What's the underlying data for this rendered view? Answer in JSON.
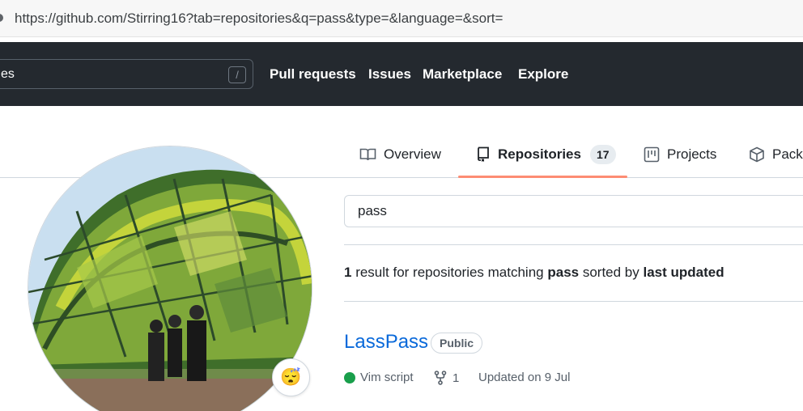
{
  "browser": {
    "url": "https://github.com/Stirring16?tab=repositories&q=pass&type=&language=&sort="
  },
  "header": {
    "search_text": "es",
    "search_shortcut": "/",
    "nav": [
      "Pull requests",
      "Issues",
      "Marketplace",
      "Explore"
    ]
  },
  "tabs": [
    {
      "label": "Overview",
      "icon": "book-icon"
    },
    {
      "label": "Repositories",
      "icon": "repo-icon",
      "count": "17",
      "active": true
    },
    {
      "label": "Projects",
      "icon": "project-icon"
    },
    {
      "label": "Packa",
      "icon": "package-icon"
    }
  ],
  "profile": {
    "status_emoji": "😴"
  },
  "filter": {
    "query": "pass"
  },
  "results": {
    "count": "1",
    "text_a": " result for repositories matching ",
    "query": "pass",
    "text_b": " sorted by ",
    "sort": "last updated"
  },
  "repo": {
    "name": "LassPass",
    "visibility": "Public",
    "language": "Vim script",
    "language_color": "#199f4b",
    "forks": "1",
    "updated": "Updated on 9 Jul"
  },
  "colors": {
    "header_bg": "#24292f",
    "link": "#0969da",
    "tab_underline": "#fd8c73"
  }
}
